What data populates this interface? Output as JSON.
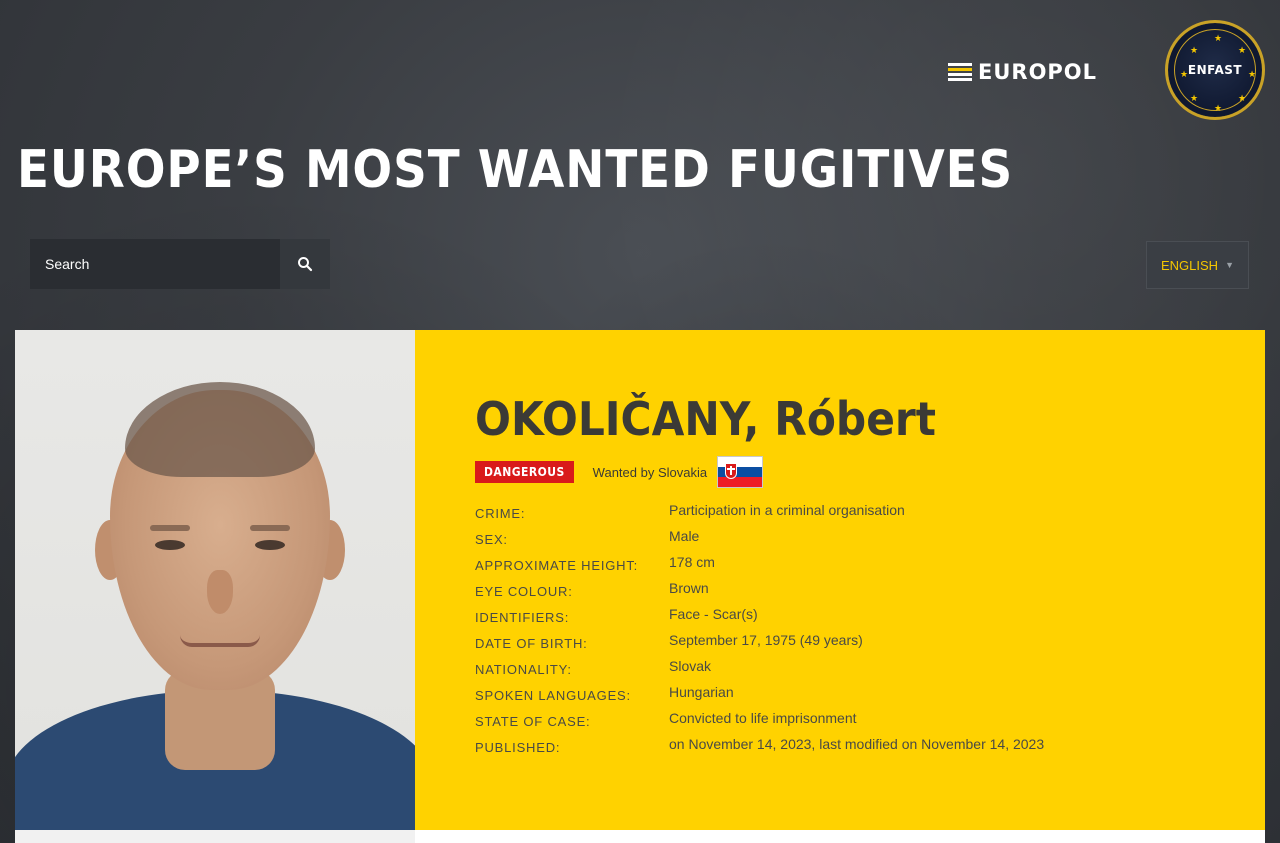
{
  "header": {
    "europol_logo_text": "EUROPOL",
    "enfast_logo_text": "ENFAST",
    "page_title": "EUROPE’S MOST WANTED FUGITIVES"
  },
  "search": {
    "placeholder": "Search",
    "button_icon": "search-icon"
  },
  "language": {
    "selected": "ENGLISH",
    "icon": "chevron-down-icon"
  },
  "fugitive": {
    "name": "OKOLIČANY, Róbert",
    "badge": "DANGEROUS",
    "wanted_by": "Wanted by Slovakia",
    "flag": "slovakia-flag",
    "details": [
      {
        "label": "CRIME:",
        "value": "Participation in a criminal organisation"
      },
      {
        "label": "SEX:",
        "value": "Male"
      },
      {
        "label": "APPROXIMATE HEIGHT:",
        "value": "178 cm"
      },
      {
        "label": "EYE COLOUR:",
        "value": "Brown"
      },
      {
        "label": "IDENTIFIERS:",
        "value": "Face - Scar(s)"
      },
      {
        "label": "DATE OF BIRTH:",
        "value": "September 17, 1975 (49 years)"
      },
      {
        "label": "NATIONALITY:",
        "value": "Slovak"
      },
      {
        "label": "SPOKEN LANGUAGES:",
        "value": "Hungarian"
      },
      {
        "label": "STATE OF CASE:",
        "value": "Convicted to life imprisonment"
      },
      {
        "label": "PUBLISHED:",
        "value": "on November 14, 2023, last modified on November 14, 2023"
      }
    ]
  },
  "colors": {
    "accent_yellow": "#ffd200",
    "danger_red": "#d91a1a",
    "background_dark": "#3a3d42",
    "text_dark": "#3b3a36"
  }
}
